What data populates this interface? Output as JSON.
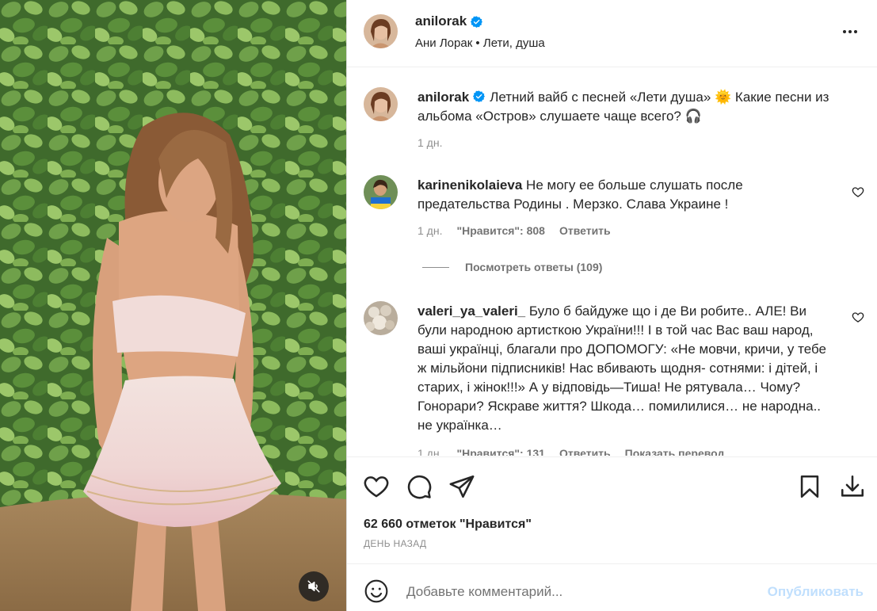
{
  "post": {
    "username": "anilorak",
    "subtitle": "Ани Лорак • Лети, душа",
    "likes_text": "62 660 отметок \"Нравится\"",
    "date_text": "ДЕНЬ НАЗАД"
  },
  "caption": {
    "username": "anilorak",
    "text": "Летний вайб с песней «Лети душа» 🌞 Какие песни из альбома «Остров» слушаете чаще всего? 🎧",
    "time": "1 дн."
  },
  "comments": [
    {
      "username": "karinenikolaieva",
      "text": "Не могу ее больше слушать после предательства Родины . Мерзко. Слава Украине !",
      "time": "1 дн.",
      "likes": "\"Нравится\": 808",
      "reply": "Ответить",
      "view_replies": "Посмотреть ответы (109)"
    },
    {
      "username": "valeri_ya_valeri_",
      "text": "Було б байдуже що і де Ви робите.. АЛЕ! Ви були народною артисткою України!!! І в той час Вас ваш народ, ваші українці, благали про ДОПОМОГУ: «Не мовчи, кричи, у тебе ж мільйони підписників! Нас вбивають щодня- сотнями: і дітей, і старих, і жінок!!!» А у відповідь—Тиша! Не рятувала… Чому? Гонорари? Яскраве життя? Шкода… помилилися… не народна.. не українка…",
      "time": "1 дн.",
      "likes": "\"Нравится\": 131",
      "reply": "Ответить",
      "translate": "Показать перевод"
    }
  ],
  "composer": {
    "placeholder": "Добавьте комментарий...",
    "publish": "Опубликовать"
  },
  "icons": {
    "more": "more-horizontal-icon",
    "like": "heart-icon",
    "comment": "comment-icon",
    "share": "paper-plane-icon",
    "save": "bookmark-icon",
    "download": "download-icon",
    "emoji": "smiley-icon",
    "mute": "speaker-muted-icon",
    "verified": "verified-badge-icon"
  },
  "colors": {
    "verified": "#0095f6",
    "publish_disabled": "#c0dffd",
    "muted_text": "#8e8e8e"
  }
}
